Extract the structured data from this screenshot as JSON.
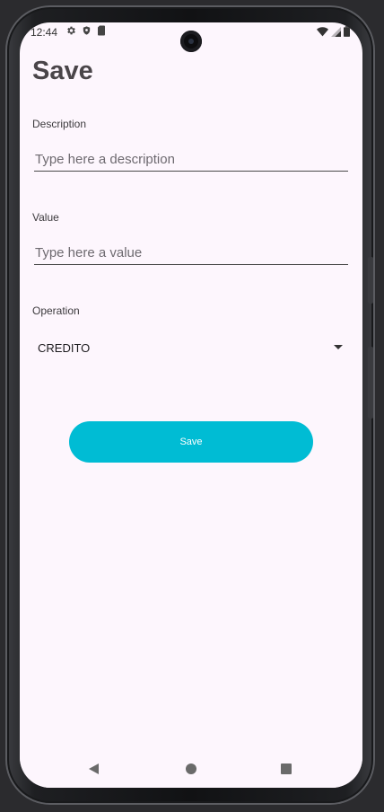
{
  "status_bar": {
    "time": "12:44",
    "left_icons": [
      "settings-icon",
      "shield-icon",
      "sim-card-icon"
    ],
    "right_icons": [
      "wifi-icon",
      "signal-icon",
      "battery-icon"
    ]
  },
  "header": {
    "title": "Save"
  },
  "form": {
    "description": {
      "label": "Description",
      "placeholder": "Type here a description",
      "value": ""
    },
    "value": {
      "label": "Value",
      "placeholder": "Type here a value",
      "value": ""
    },
    "operation": {
      "label": "Operation",
      "selected": "CREDITO"
    },
    "save_label": "Save"
  },
  "navigation": {
    "icons": [
      "back-icon",
      "home-icon",
      "recents-icon"
    ]
  },
  "colors": {
    "accent": "#00bcd4",
    "background": "#fdf6fd",
    "title": "#4a4549"
  }
}
